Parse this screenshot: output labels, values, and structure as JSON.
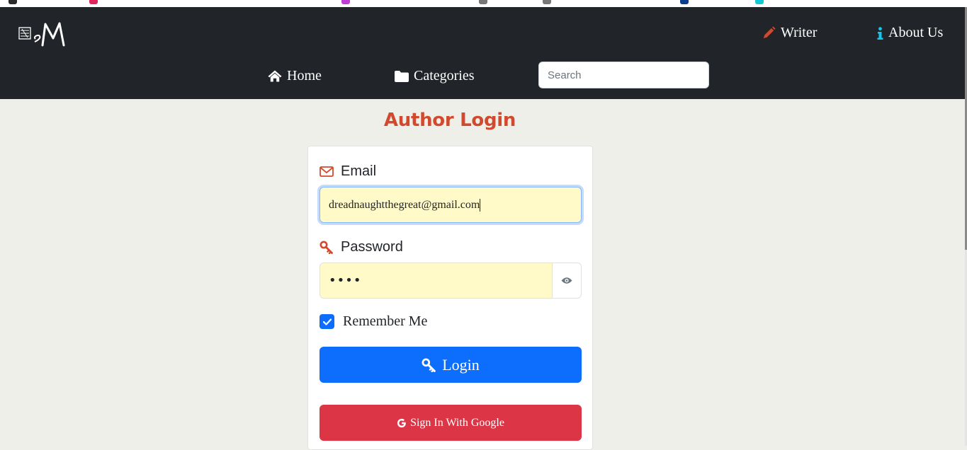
{
  "navbar": {
    "brand_alt": "sM",
    "writer_label": "Writer",
    "about_label": "About Us",
    "home_label": "Home",
    "categories_label": "Categories",
    "search_placeholder": "Search"
  },
  "page": {
    "title": "Author Login"
  },
  "form": {
    "email_label": "Email",
    "email_value": "dreadnaughtthegreat@gmail.com",
    "password_label": "Password",
    "password_value": "abcd",
    "remember_label": "Remember Me",
    "remember_checked": true,
    "login_label": "Login",
    "google_label": "Sign In With Google"
  },
  "colors": {
    "navbar_bg": "#212529",
    "page_bg": "#efefea",
    "title": "#d24a2e",
    "autofill_bg": "#fffac8",
    "primary": "#0d6efd",
    "danger": "#dc3545",
    "icon_red": "#d24a2e",
    "info_cyan": "#0dcaf0"
  },
  "icons": {
    "brand": "brand-logo-icon",
    "writer": "pencil-icon",
    "about": "info-icon",
    "home": "home-icon",
    "categories": "folder-icon",
    "email": "envelope-icon",
    "password": "key-icon",
    "toggle_password": "eye-icon",
    "checkbox": "check-icon",
    "login": "key-icon",
    "google": "google-icon"
  }
}
